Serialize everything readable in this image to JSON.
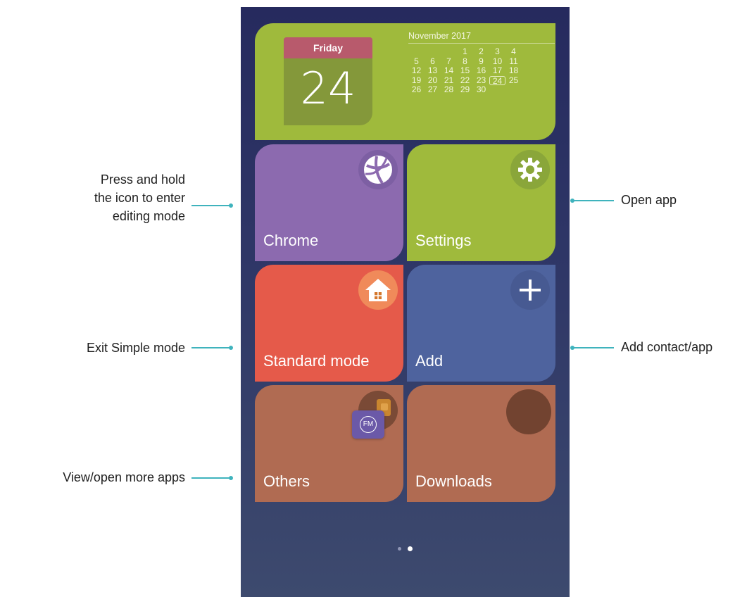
{
  "calendar": {
    "weekday": "Friday",
    "day": "24",
    "month_label": "November 2017",
    "weeks": [
      [
        "",
        "",
        "",
        "1",
        "2",
        "3",
        "4"
      ],
      [
        "5",
        "6",
        "7",
        "8",
        "9",
        "10",
        "11"
      ],
      [
        "12",
        "13",
        "14",
        "15",
        "16",
        "17",
        "18"
      ],
      [
        "19",
        "20",
        "21",
        "22",
        "23",
        "24",
        "25"
      ],
      [
        "26",
        "27",
        "28",
        "29",
        "30",
        "",
        ""
      ]
    ],
    "today": "24"
  },
  "tiles": [
    {
      "label": "Chrome",
      "icon": "chrome-globe-icon",
      "color": "#8c6aaf"
    },
    {
      "label": "Settings",
      "icon": "gear-icon",
      "color": "#9fba3c"
    },
    {
      "label": "Standard mode",
      "icon": "home-icon",
      "color": "#e55a4a"
    },
    {
      "label": "Add",
      "icon": "plus-icon",
      "color": "#4e639e"
    },
    {
      "label": "Others",
      "icon": "fm-radio-icon",
      "color": "#b06b52"
    },
    {
      "label": "Downloads",
      "icon": "downloads-icon",
      "color": "#b06b52"
    }
  ],
  "annotations": {
    "press_hold": [
      "Press and hold",
      "the icon to enter",
      "editing mode"
    ],
    "open_app": "Open app",
    "exit_simple": "Exit Simple mode",
    "add_contact": "Add contact/app",
    "view_more": "View/open more apps"
  },
  "fm_badge": "FM",
  "page_indicator": {
    "pages": 2,
    "current": 2
  },
  "colors": {
    "accent_line": "#3fb3bd",
    "background": "#262a5e"
  }
}
